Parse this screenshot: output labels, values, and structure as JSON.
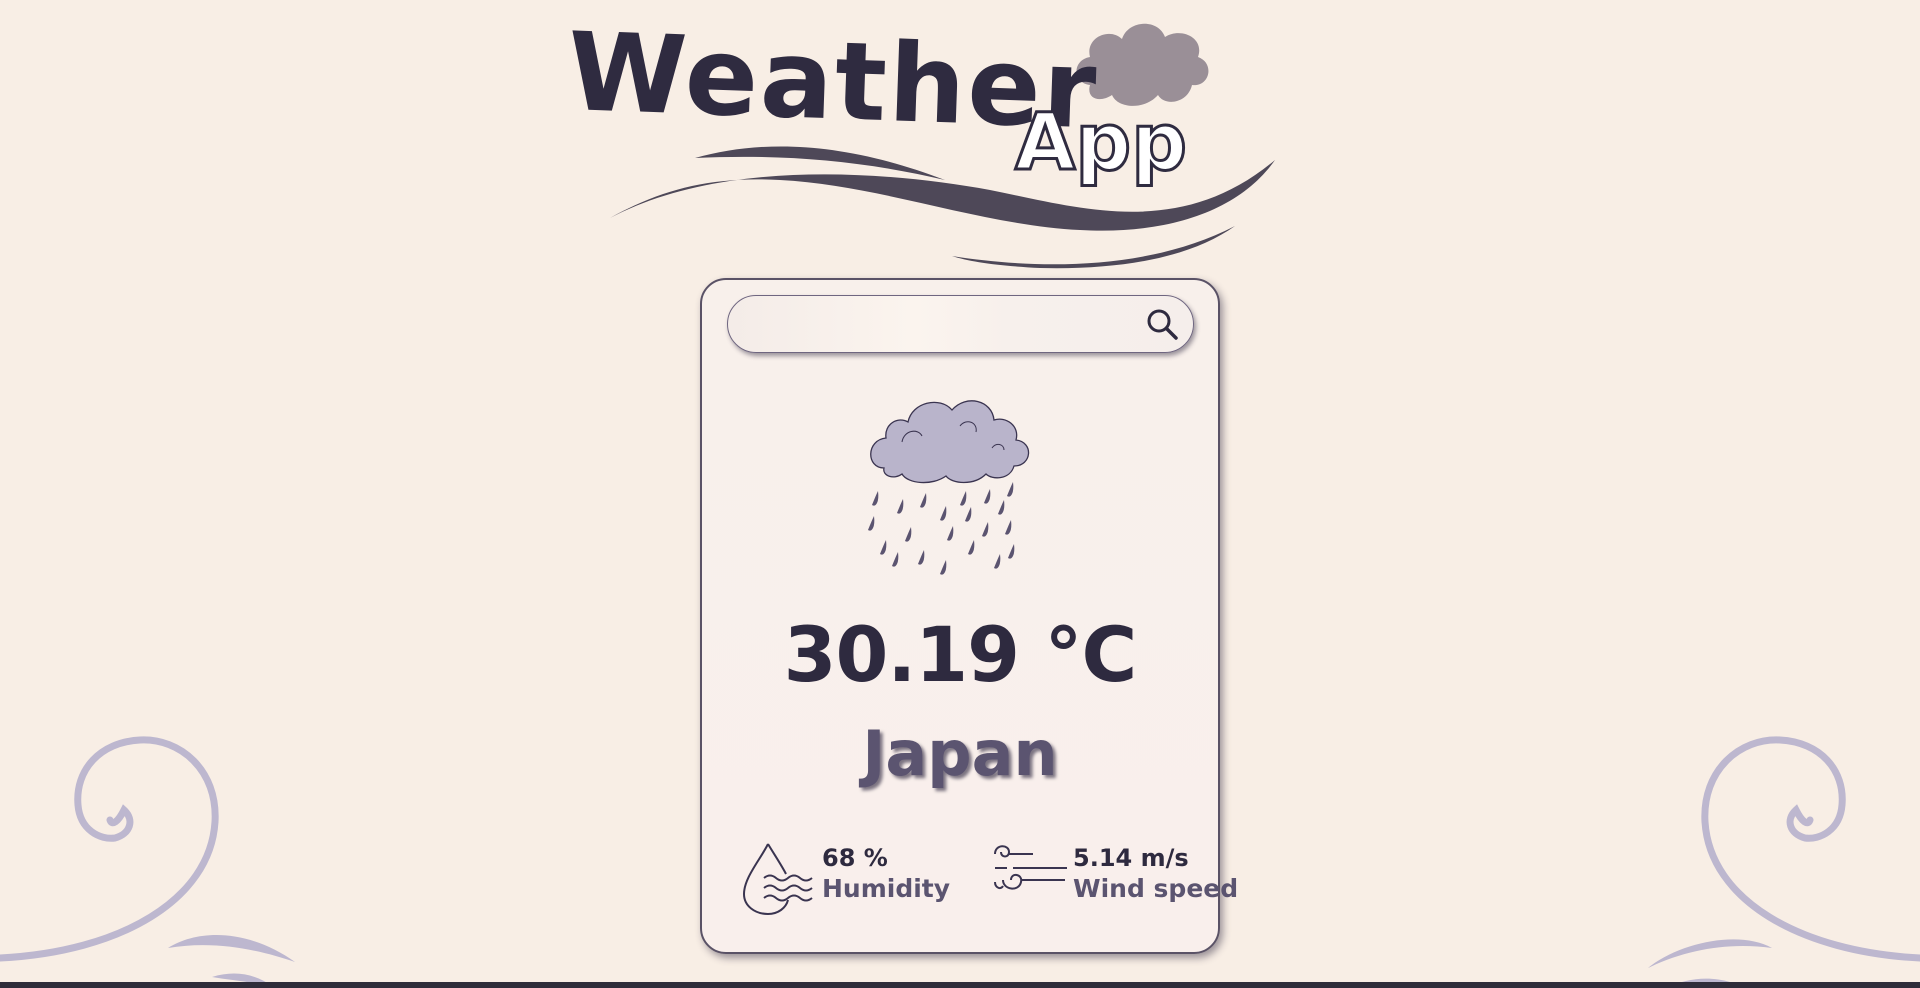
{
  "logo": {
    "title_word": "Weather",
    "sub_word": "App"
  },
  "search": {
    "value": "",
    "placeholder": ""
  },
  "weather": {
    "condition_icon": "rain-cloud-icon",
    "temperature": "30.19 °C",
    "city": "Japan"
  },
  "details": {
    "humidity": {
      "value": "68 %",
      "label": "Humidity",
      "icon": "humidity-drop-icon"
    },
    "wind": {
      "value": "5.14 m/s",
      "label": "Wind speed",
      "icon": "wind-icon"
    }
  },
  "colors": {
    "background": "#f8eee5",
    "ink": "#2e2a3f",
    "muted": "#5b5470",
    "swirl": "#bdb7cf",
    "cloud": "#b9b4cb"
  }
}
